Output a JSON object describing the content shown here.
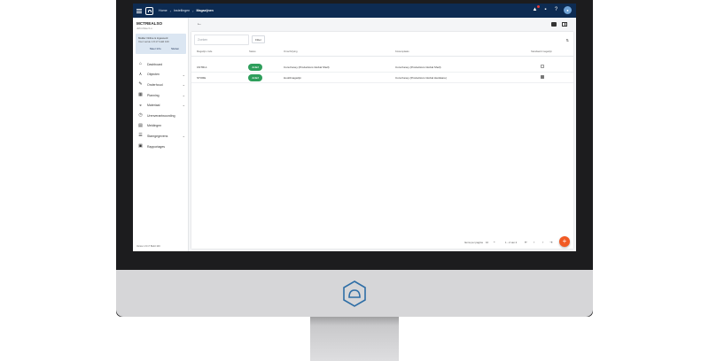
{
  "topbar": {
    "breadcrumbs": [
      "Home",
      "Instellingen",
      "Magazijnen"
    ]
  },
  "sidebar": {
    "company": "MCTREALSO",
    "company_sub": "John Doe b.v.",
    "login": {
      "line1": "Mulder Online is ingevoerd",
      "line2": "Voor versie 1.8.17 build 100",
      "info_label": "Meer Info",
      "logout_label": "Sluiten"
    },
    "items": [
      {
        "label": "Dashboard",
        "icon": "home-icon",
        "chevron": false
      },
      {
        "label": "Objecten",
        "icon": "tree-icon",
        "chevron": true
      },
      {
        "label": "Onderhoud",
        "icon": "wrench-icon",
        "chevron": true
      },
      {
        "label": "Planning",
        "icon": "calendar-icon",
        "chevron": true
      },
      {
        "label": "Materiaal",
        "icon": "basket-icon",
        "chevron": true
      },
      {
        "label": "Urenverantwoording",
        "icon": "clock-icon",
        "chevron": false
      },
      {
        "label": "Meldingen",
        "icon": "message-icon",
        "chevron": false
      },
      {
        "label": "Stamgegevens",
        "icon": "list-icon",
        "chevron": true
      },
      {
        "label": "Rapportages",
        "icon": "report-icon",
        "chevron": false
      }
    ],
    "version": "Versie 1.8.17 Build 100"
  },
  "toolbar": {
    "search_placeholder": "Zoeken",
    "filter_label": "Filter"
  },
  "table": {
    "headers": [
      "Magazijn code",
      "Status",
      "Omschrijving",
      "Kostenplaats",
      "Standaard magazijn"
    ],
    "rows": [
      {
        "code": "CNTRL1",
        "status": "Actief",
        "description": "Cura Kaney (Productions Global Shell)",
        "kostenplaats": "Cura Kaney (Productions Global Shell)",
        "default": false
      },
      {
        "code": "STORE",
        "status": "Actief",
        "description": "Hoofdmagazijn",
        "kostenplaats": "Cura Kaney (Productions Global Hardware)",
        "default": true
      }
    ]
  },
  "footer": {
    "rows_per_page_label": "Items per pagina",
    "rows_per_page_value": "10",
    "range": "1 - 2 van 2"
  },
  "colors": {
    "topbar": "#0d2b52",
    "status_active": "#2e9e5b",
    "fab": "#f15a24",
    "login_card": "#dbe6f2"
  }
}
